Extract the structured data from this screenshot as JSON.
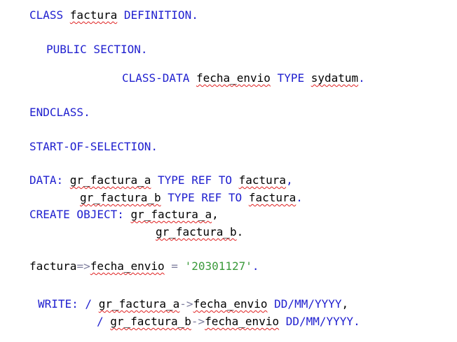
{
  "editor": {
    "lines": [
      {
        "id": "l1",
        "tokens": [
          {
            "t": "CLASS ",
            "c": "kw"
          },
          {
            "t": "factura",
            "c": "id",
            "sq": true
          },
          {
            "t": " DEFINITION",
            "c": "kw"
          },
          {
            "t": ".",
            "c": "punct"
          }
        ]
      },
      {
        "id": "l2",
        "tokens": [
          {
            "t": "PUBLIC SECTION",
            "c": "kw"
          },
          {
            "t": ".",
            "c": "punct"
          }
        ]
      },
      {
        "id": "l3",
        "tokens": [
          {
            "t": "CLASS-DATA ",
            "c": "kw"
          },
          {
            "t": "fecha_envio",
            "c": "id",
            "sq": true
          },
          {
            "t": " TYPE ",
            "c": "kw"
          },
          {
            "t": "sydatum",
            "c": "id",
            "sq": true
          },
          {
            "t": ".",
            "c": "punct"
          }
        ]
      },
      {
        "id": "l4",
        "tokens": [
          {
            "t": "ENDCLASS",
            "c": "kw"
          },
          {
            "t": ".",
            "c": "punct"
          }
        ]
      },
      {
        "id": "l5",
        "tokens": [
          {
            "t": "START-OF-SELECTION",
            "c": "kw"
          },
          {
            "t": ".",
            "c": "punct"
          }
        ]
      },
      {
        "id": "l6",
        "tokens": [
          {
            "t": "DATA: ",
            "c": "kw"
          },
          {
            "t": "gr_factura_a",
            "c": "id",
            "sq": true
          },
          {
            "t": " TYPE REF TO ",
            "c": "kw"
          },
          {
            "t": "factura",
            "c": "id",
            "sq": true
          },
          {
            "t": ",",
            "c": "punct"
          }
        ]
      },
      {
        "id": "l7",
        "tokens": [
          {
            "t": "gr_factura_b",
            "c": "id",
            "sq": true
          },
          {
            "t": " TYPE REF TO ",
            "c": "kw"
          },
          {
            "t": "factura",
            "c": "id",
            "sq": true
          },
          {
            "t": ".",
            "c": "punct"
          }
        ]
      },
      {
        "id": "l8",
        "tokens": [
          {
            "t": "CREATE OBJECT: ",
            "c": "kw"
          },
          {
            "t": "gr_factura_a",
            "c": "id",
            "sq": true
          },
          {
            "t": ",",
            "c": "plain"
          }
        ]
      },
      {
        "id": "l9",
        "tokens": [
          {
            "t": "gr_factura_b",
            "c": "id",
            "sq": true
          },
          {
            "t": ".",
            "c": "plain"
          }
        ]
      },
      {
        "id": "l10",
        "tokens": [
          {
            "t": "factura",
            "c": "id"
          },
          {
            "t": "=>",
            "c": "arrow"
          },
          {
            "t": "fecha_envio",
            "c": "id",
            "sq": true
          },
          {
            "t": " = ",
            "c": "arrow"
          },
          {
            "t": "'20301127'",
            "c": "str"
          },
          {
            "t": ".",
            "c": "punct"
          }
        ]
      },
      {
        "id": "l11",
        "tokens": [
          {
            "t": "WRITE: / ",
            "c": "kw"
          },
          {
            "t": "gr_factura_a",
            "c": "id",
            "sq": true
          },
          {
            "t": "->",
            "c": "arrow"
          },
          {
            "t": "fecha_envio",
            "c": "id",
            "sq": true
          },
          {
            "t": " DD/MM/YYYY",
            "c": "kw"
          },
          {
            "t": ",",
            "c": "plain"
          }
        ]
      },
      {
        "id": "l12",
        "tokens": [
          {
            "t": "/ ",
            "c": "kw"
          },
          {
            "t": "gr_factura_b",
            "c": "id",
            "sq": true
          },
          {
            "t": "->",
            "c": "arrow"
          },
          {
            "t": "fecha_envio",
            "c": "id",
            "sq": true
          },
          {
            "t": " DD/MM/YYYY",
            "c": "kw"
          },
          {
            "t": ".",
            "c": "punct"
          }
        ]
      }
    ]
  }
}
